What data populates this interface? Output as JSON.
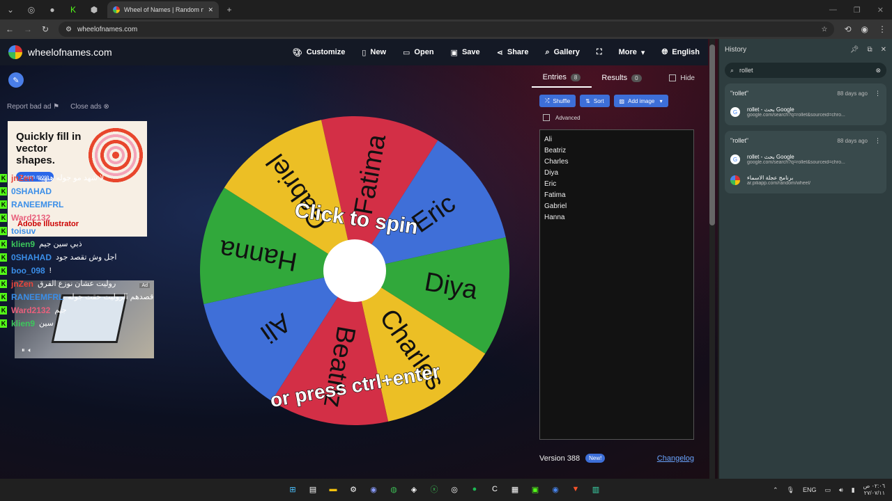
{
  "browser": {
    "active_tab_title": "Wheel of Names | Random nam",
    "url": "wheelofnames.com",
    "new_tab_symbol": "+"
  },
  "site": {
    "logo_text": "wheelofnames.com",
    "nav": {
      "customize": "Customize",
      "new": "New",
      "open": "Open",
      "save": "Save",
      "share": "Share",
      "gallery": "Gallery",
      "more": "More",
      "language": "English"
    },
    "report_bad_ad": "Report bad ad",
    "close_ads": "Close ads",
    "ad1": {
      "headline": "Quickly fill in vector shapes.",
      "cta": "Learn more",
      "brand": "Adobe Illustrator"
    },
    "ad2": {
      "label": "Ad"
    },
    "wheel": {
      "segments": [
        "Fatima",
        "Eric",
        "Diya",
        "Charles",
        "Beatriz",
        "Ali",
        "Hanna",
        "Gabriel"
      ],
      "colors": {
        "red": "#d32f46",
        "blue": "#3f6fd8",
        "green": "#31a83b",
        "yellow": "#ecbf25"
      },
      "spin_text": "Click to spin",
      "press_text": "or press ctrl+enter"
    },
    "panel": {
      "tab_entries": "Entries",
      "entries_count": "8",
      "tab_results": "Results",
      "results_count": "0",
      "hide_label": "Hide",
      "shuffle": "Shuffle",
      "sort": "Sort",
      "add_image": "Add image",
      "advanced": "Advanced",
      "entries": [
        "Ali",
        "Beatriz",
        "Charles",
        "Diya",
        "Eric",
        "Fatima",
        "Gabriel",
        "Hanna"
      ],
      "version": "Version 388",
      "new_badge": "New!",
      "changelog": "Changelog"
    }
  },
  "chat": [
    {
      "user": "jnZen",
      "msg": "لا شهد مو جوله هيهيه",
      "color": "#e8463c"
    },
    {
      "user": "0SHAHAD",
      "msg": "",
      "color": "#3a8ee8"
    },
    {
      "user": "RANEEMFRL",
      "msg": "",
      "color": "#3a8ee8"
    },
    {
      "user": "Ward2132",
      "msg": "",
      "color": "#e8607c"
    },
    {
      "user": "toisuv",
      "msg": "",
      "color": "#3a8ee8"
    },
    {
      "user": "klien9",
      "msg": "ذبي سين جيم",
      "color": "#3cc85c"
    },
    {
      "user": "0SHAHAD",
      "msg": "اجل وش تقصد جود",
      "color": "#3a8ee8"
    },
    {
      "user": "boo_098",
      "msg": "!",
      "color": "#3a8ee8"
    },
    {
      "user": "jnZen",
      "msg": "روليت عشان نوزع الفرق",
      "color": "#e8463c"
    },
    {
      "user": "RANEEMFRL",
      "msg": "قصدهم الروليت حقت جوله",
      "color": "#3a8ee8"
    },
    {
      "user": "Ward2132",
      "msg": "جيم",
      "color": "#e8607c"
    },
    {
      "user": "klien9",
      "msg": "سين",
      "color": "#3cc85c"
    }
  ],
  "history": {
    "title": "History",
    "search_value": "rollet",
    "groups": [
      {
        "query": "\"rollet\"",
        "ago": "88 days ago",
        "items": [
          {
            "title": "rollet - بحث Google",
            "url": "google.com/search?q=rollet&sourceid=chro..."
          }
        ]
      },
      {
        "query": "\"rollet\"",
        "ago": "88 days ago",
        "items": [
          {
            "title": "rollet - بحث Google",
            "url": "google.com/search?q=rollet&sourceid=chro..."
          },
          {
            "title": "برنامج عجلة الاسماء",
            "url": "ar.piliapp.com/random/wheel/"
          }
        ]
      }
    ]
  },
  "taskbar": {
    "lang": "ENG",
    "time": "٠٢:٠٦ ص",
    "date": "٢٧/٠٧/١١"
  }
}
